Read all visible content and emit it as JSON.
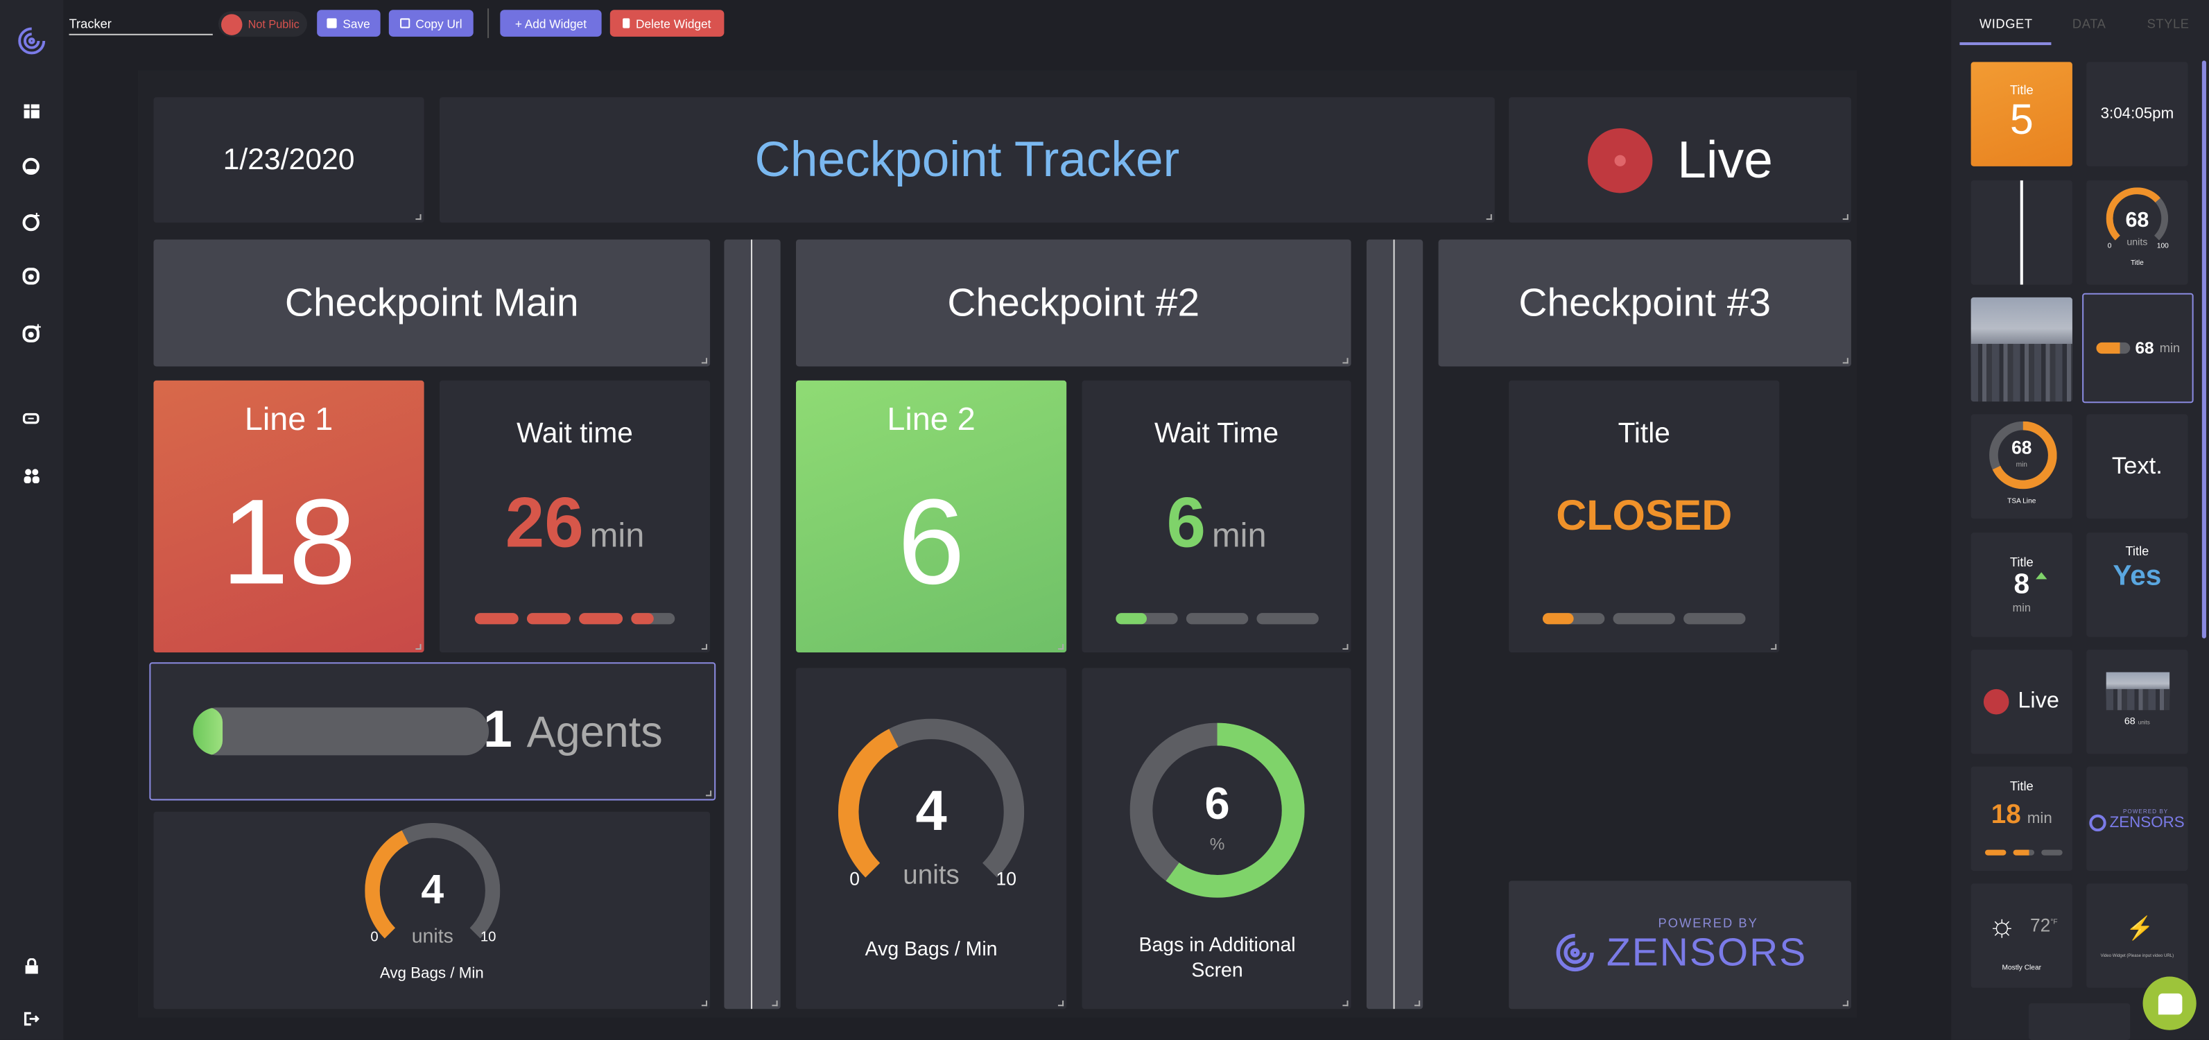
{
  "toolbar": {
    "dashboard_name": "Tracker",
    "visibility_label": "Not Public",
    "save_label": "Save",
    "copy_url_label": "Copy Url",
    "add_widget_label": "+ Add Widget",
    "delete_widget_label": "Delete Widget"
  },
  "sidebar": {
    "icons": [
      "logo-icon",
      "layout-icon",
      "gauge-icon",
      "add-gauge-icon",
      "camera-icon",
      "add-camera-icon",
      "link-icon",
      "users-icon",
      "lock-icon",
      "logout-icon"
    ]
  },
  "dashboard": {
    "date": "1/23/2020",
    "title": "Checkpoint Tracker",
    "live_label": "Live",
    "sections": [
      "Checkpoint Main",
      "Checkpoint #2",
      "Checkpoint #3"
    ],
    "line1": {
      "title": "Line 1",
      "value": "18",
      "color": "#d35a47"
    },
    "wait1": {
      "title": "Wait time",
      "value": "26",
      "unit": "min",
      "segments": [
        1,
        1,
        1,
        0.5
      ],
      "color": "#d7574a"
    },
    "line2": {
      "title": "Line 2",
      "value": "6",
      "color": "#86d36f"
    },
    "wait2": {
      "title": "Wait Time",
      "value": "6",
      "unit": "min",
      "segments": [
        0.5,
        0,
        0
      ],
      "color": "#7fd36a"
    },
    "status3": {
      "title": "Title",
      "value": "CLOSED",
      "segments": [
        0.5,
        0,
        0
      ],
      "color": "#f0922a"
    },
    "agents": {
      "value": "1",
      "label": "Agents",
      "fill": 0.05
    },
    "gauge_small": {
      "value": "4",
      "unit": "units",
      "min": "0",
      "max": "10",
      "label": "Avg Bags / Min",
      "fraction": 0.4
    },
    "gauge_mid": {
      "value": "4",
      "unit": "units",
      "min": "0",
      "max": "10",
      "label": "Avg Bags / Min",
      "fraction": 0.4
    },
    "ring": {
      "value": "6",
      "unit": "%",
      "label": "Bags in Additional Screen",
      "label_shown": "Bags in Additional Scren",
      "fill": 0.6
    },
    "powered": {
      "small": "POWERED BY",
      "brand": "ZENSORS"
    }
  },
  "right_panel": {
    "tabs": [
      "WIDGET",
      "DATA",
      "STYLE"
    ],
    "active_tab": "WIDGET",
    "thumbs": {
      "count": {
        "title": "Title",
        "value": "5"
      },
      "clock": "3:04:05pm",
      "gauge": {
        "value": "68",
        "unit": "units",
        "min": "0",
        "max": "100",
        "title": "Title"
      },
      "bar": {
        "value": "68",
        "unit": "min"
      },
      "ring": {
        "value": "68",
        "unit": "min",
        "label": "TSA Line"
      },
      "text": "Text.",
      "trend": {
        "title": "Title",
        "value": "8",
        "unit": "min"
      },
      "bool": {
        "title": "Title",
        "value": "Yes"
      },
      "live": "Live",
      "image": {
        "value": "68",
        "unit": "units"
      },
      "wait": {
        "title": "Title",
        "value": "18",
        "unit": "min"
      },
      "powered": {
        "small": "POWERED BY",
        "brand": "ZENSORS"
      },
      "weather": {
        "temp": "72",
        "unit": "°F",
        "desc": "Mostly Clear"
      },
      "video": "Video Widget (Please input video URL)"
    }
  },
  "colors": {
    "accent": "#7272e0",
    "danger": "#d9534f",
    "orange": "#f0922a",
    "green": "#86d36f",
    "blue": "#7ab8f0",
    "chat": "#9dc43a"
  }
}
